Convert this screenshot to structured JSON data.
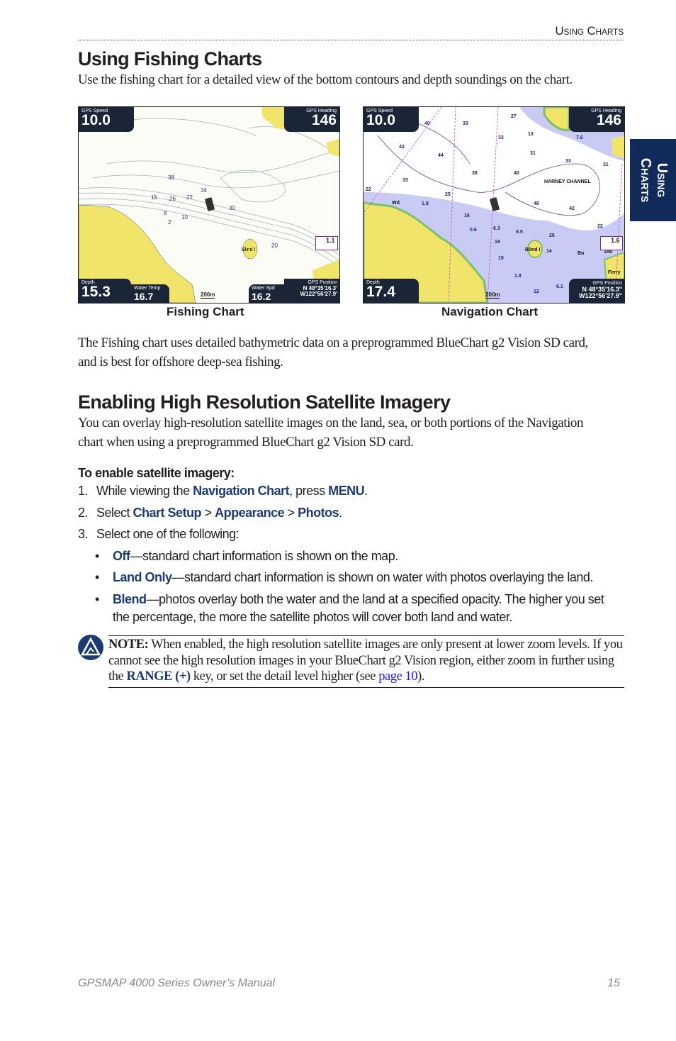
{
  "header": {
    "running_title": "Using Charts"
  },
  "side_tab": {
    "label": "Using Charts",
    "color": "#112a5a"
  },
  "section1": {
    "title": "Using Fishing Charts",
    "intro": "Use the fishing chart for a detailed view of the bottom contours and depth soundings on the chart.",
    "figures": [
      {
        "caption": "Fishing Chart",
        "gps_speed_label": "GPS Speed",
        "gps_speed": "10.0",
        "gps_heading_label": "GPS Heading",
        "gps_heading": "146",
        "depth_label": "Depth",
        "depth": "15.3",
        "water_temp_label": "Water Temp",
        "water_temp": "16.7",
        "water_spd_label": "Water Spd",
        "water_spd": "16.2",
        "gps_position_label": "GPS Position",
        "lat": "N  48°35'16.3'",
        "lon": "W122°56'27.9'",
        "scale": "200m",
        "tide": "1.1",
        "labels": [
          "38",
          "34",
          "15",
          "26",
          "22",
          "30",
          "8",
          "10",
          "2",
          "20",
          "Blind I"
        ]
      },
      {
        "caption": "Navigation Chart",
        "gps_speed_label": "GPS Speed",
        "gps_speed": "10.0",
        "gps_heading_label": "GPS Heading",
        "gps_heading": "146",
        "depth_label": "Depth",
        "depth": "17.4",
        "gps_position_label": "GPS Position",
        "lat": "N  48°35'16.3\"",
        "lon": "W122°56'27.9\"",
        "scale": "200m",
        "tide": "1.6",
        "labels": [
          "40",
          "33",
          "27",
          "13",
          "7.6",
          "42",
          "44",
          "33",
          "31",
          "33",
          "31",
          "38",
          "40",
          "HARNEY CHANNEL",
          "22",
          "25",
          "Wd",
          "1.8",
          "16",
          "0.6",
          "6.3",
          "8.5",
          "19",
          "26",
          "22",
          "40",
          "42",
          "Blind I",
          "14",
          "19",
          "Bn",
          "Dol",
          "Ferry",
          "1.8",
          "12",
          "6.1"
        ]
      }
    ],
    "para": [
      "The Fishing chart uses detailed bathymetric data on a preprogrammed BlueChart g2 Vision SD card,",
      "and is best for offshore deep-sea fishing."
    ]
  },
  "section2": {
    "title": "Enabling High Resolution Satellite Imagery",
    "intro": [
      "You can overlay high-resolution satellite images on the land, sea, or both portions of the Navigation",
      "chart when using a preprogrammed BlueChart g2 Vision SD card."
    ],
    "procedure_title": "To enable satellite imagery:",
    "steps": [
      {
        "num": "1.",
        "pre": "While viewing the ",
        "b1": "Navigation Chart",
        "mid": ", press ",
        "b2": "MENU",
        "post": "."
      },
      {
        "num": "2.",
        "pre": "Select ",
        "b1": "Chart Setup",
        "sep1": " > ",
        "b2": "Appearance",
        "sep2": " > ",
        "b3": "Photos",
        "post": "."
      },
      {
        "num": "3.",
        "text": "Select one of the following:"
      }
    ],
    "bullets": [
      {
        "term": "Off",
        "text": "—standard chart information is shown on the map."
      },
      {
        "term": "Land Only",
        "text": "—standard chart information is shown on water with photos overlaying the land."
      },
      {
        "term": "Blend",
        "text": "—photos overlay both the water and the land at a specified opacity. The higher you set",
        "text2": "the percentage, the more the satellite photos will cover both land and water."
      }
    ],
    "note": {
      "label": "NOTE:",
      "line1": " When enabled, the high resolution satellite images are only present at lower zoom levels. If you",
      "line2": "cannot see the high resolution images in your BlueChart g2 Vision region, either zoom in further using",
      "pre3": "the ",
      "key": "RANGE (+)",
      "mid3": " key, or set the detail level higher (see ",
      "link": "page 10",
      "post3": ")."
    }
  },
  "footer": {
    "manual": "GPSMAP 4000 Series Owner’s Manual",
    "page": "15"
  },
  "colors": {
    "accent": "#1d3b72",
    "link": "#1a1aff",
    "land": "#f0e46a",
    "shallow": "#c8ccf5",
    "overlay": "#1a2638"
  }
}
